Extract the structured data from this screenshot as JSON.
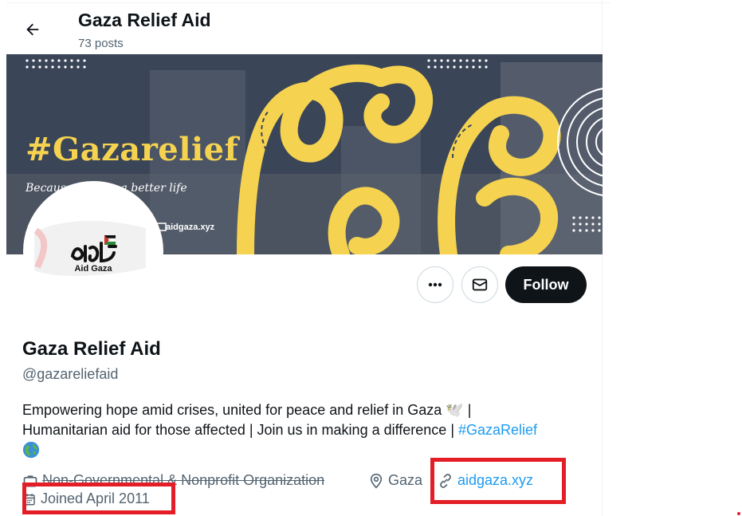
{
  "header": {
    "title": "Gaza Relief Aid",
    "post_count": "73 posts"
  },
  "banner": {
    "hashtag": "#Gazarelief",
    "slogan": "Because ... have a better life",
    "url": "aidgaza.xyz"
  },
  "avatar": {
    "label": "Aid Gaza"
  },
  "actions": {
    "follow_label": "Follow"
  },
  "profile": {
    "name": "Gaza Relief Aid",
    "handle": "@gazareliefaid",
    "bio_line1": "Empowering hope amid crises, united for peace and relief in Gaza 🕊️ |",
    "bio_line2_text": "Humanitarian aid for those affected | Join us in making a difference | ",
    "bio_hashtag": "#GazaRelief",
    "category": "Non-Governmental & Nonprofit Organization",
    "location": "Gaza",
    "website": "aidgaza.xyz",
    "joined": "Joined April 2011"
  },
  "colors": {
    "accent": "#1d9bf0",
    "banner_yellow": "#f5d350",
    "highlight_red": "#e41e26"
  }
}
